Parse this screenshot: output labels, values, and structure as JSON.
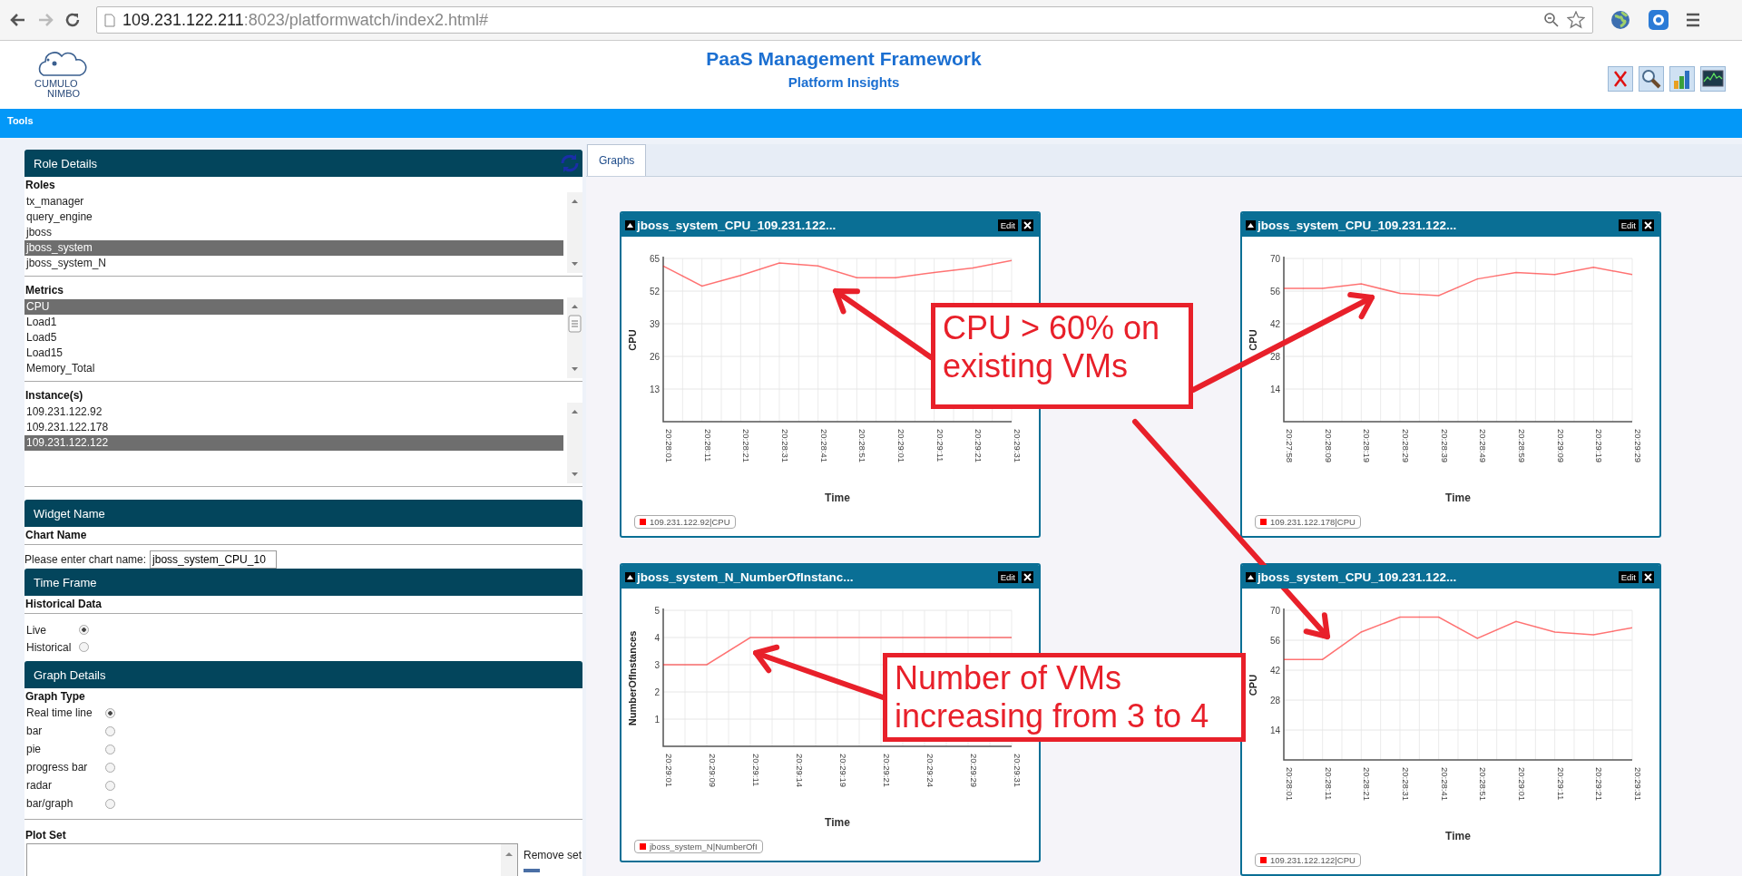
{
  "browser": {
    "url_host": "109.231.122.211",
    "url_path": ":8023/platformwatch/index2.html#"
  },
  "header": {
    "logo": [
      "CUMULO",
      "NIMBO"
    ],
    "title": "PaaS Management Framework",
    "subtitle": "Platform Insights"
  },
  "menu_bar": [
    "Tools"
  ],
  "sidebar": {
    "role_details": {
      "title": "Role Details",
      "lists": [
        {
          "label": "Roles",
          "items": [
            {
              "text": "tx_manager",
              "selected": false
            },
            {
              "text": "query_engine",
              "selected": false
            },
            {
              "text": "jboss",
              "selected": false
            },
            {
              "text": "jboss_system",
              "selected": true
            },
            {
              "text": "jboss_system_N",
              "selected": false
            }
          ]
        },
        {
          "label": "Metrics",
          "items": [
            {
              "text": "CPU",
              "selected": true
            },
            {
              "text": "Load1",
              "selected": false
            },
            {
              "text": "Load5",
              "selected": false
            },
            {
              "text": "Load15",
              "selected": false
            },
            {
              "text": "Memory_Total",
              "selected": false
            }
          ]
        },
        {
          "label": "Instance(s)",
          "items": [
            {
              "text": "109.231.122.92",
              "selected": false
            },
            {
              "text": "109.231.122.178",
              "selected": false
            },
            {
              "text": "109.231.122.122",
              "selected": true
            }
          ]
        }
      ]
    },
    "widget_name": {
      "title": "Widget Name",
      "heading": "Chart Name",
      "field_label": "Please enter chart name:",
      "field_value": "jboss_system_CPU_10"
    },
    "time_frame": {
      "title": "Time Frame",
      "heading": "Historical Data",
      "options": [
        {
          "label": "Live",
          "selected": true
        },
        {
          "label": "Historical",
          "selected": false
        }
      ]
    },
    "graph_details": {
      "title": "Graph Details",
      "heading": "Graph Type",
      "options": [
        {
          "label": "Real time line",
          "selected": true
        },
        {
          "label": "bar",
          "selected": false
        },
        {
          "label": "pie",
          "selected": false
        },
        {
          "label": "progress bar",
          "selected": false
        },
        {
          "label": "radar",
          "selected": false
        },
        {
          "label": "bar/graph",
          "selected": false
        }
      ]
    },
    "plot_set": {
      "heading": "Plot Set",
      "remove_label": "Remove set"
    }
  },
  "tabs": [
    {
      "label": "Graphs",
      "selected": true
    }
  ],
  "widgets": [
    {
      "title": "jboss_system_CPU_109.231.122...",
      "edit_label": "Edit",
      "chart_data": {
        "type": "line",
        "xlabel": "Time",
        "ylabel": "CPU",
        "categories": [
          "20:28:01",
          "20:28:11",
          "20:28:21",
          "20:28:31",
          "20:28:41",
          "20:28:51",
          "20:29:01",
          "20:29:11",
          "20:29:21",
          "20:29:31"
        ],
        "ylim": [
          0,
          65
        ],
        "yticks": [
          13,
          26,
          39,
          52,
          65
        ],
        "grid": true,
        "series": [
          {
            "name": "109.231.122.92|CPU",
            "color": "#ff0000",
            "values": [
              62,
              54,
              58.2,
              63.2,
              62,
              57.3,
              57.3,
              59.4,
              61.2,
              64.2
            ]
          }
        ]
      }
    },
    {
      "title": "jboss_system_CPU_109.231.122...",
      "edit_label": "Edit",
      "chart_data": {
        "type": "line",
        "xlabel": "Time",
        "ylabel": "CPU",
        "categories": [
          "20:27:58",
          "20:28:09",
          "20:28:19",
          "20:28:29",
          "20:28:39",
          "20:28:49",
          "20:28:59",
          "20:29:09",
          "20:29:19",
          "20:29:29"
        ],
        "ylim": [
          0,
          70
        ],
        "yticks": [
          14,
          28,
          42,
          56,
          70
        ],
        "grid": true,
        "series": [
          {
            "name": "109.231.122.178|CPU",
            "color": "#ff0000",
            "values": [
              57.2,
              57.2,
              59.1,
              55,
              54.1,
              61.2,
              64,
              63.1,
              66.2,
              63.1
            ]
          }
        ]
      }
    },
    {
      "title": "jboss_system_N_NumberOfInstanc...",
      "edit_label": "Edit",
      "chart_data": {
        "type": "line",
        "xlabel": "Time",
        "ylabel": "NumberOfInstances",
        "categories": [
          "20:29:01",
          "20:29:09",
          "20:29:11",
          "20:29:14",
          "20:29:19",
          "20:29:21",
          "20:29:24",
          "20:29:29",
          "20:29:31"
        ],
        "ylim": [
          0,
          5
        ],
        "yticks": [
          1,
          2,
          3,
          4,
          5
        ],
        "grid": true,
        "series": [
          {
            "name": "jboss_system_N|NumberOfI",
            "color": "#ff0000",
            "values": [
              3,
              3,
              4,
              4,
              4,
              4,
              4,
              4,
              4
            ]
          }
        ]
      }
    },
    {
      "title": "jboss_system_CPU_109.231.122...",
      "edit_label": "Edit",
      "chart_data": {
        "type": "line",
        "xlabel": "Time",
        "ylabel": "CPU",
        "categories": [
          "20:28:01",
          "20:28:11",
          "20:28:21",
          "20:28:31",
          "20:28:41",
          "20:28:51",
          "20:29:01",
          "20:29:11",
          "20:29:21",
          "20:29:31"
        ],
        "ylim": [
          0,
          70
        ],
        "yticks": [
          14,
          28,
          42,
          56,
          70
        ],
        "grid": true,
        "series": [
          {
            "name": "109.231.122.122|CPU",
            "color": "#ff0000",
            "values": [
              47,
              47,
              59.8,
              66.8,
              66.8,
              56.9,
              64.8,
              59.8,
              58.6,
              61.8
            ]
          }
        ]
      }
    }
  ],
  "annotations": [
    {
      "text": "CPU > 60% on existing VMs"
    },
    {
      "text": "Number of VMs increasing from 3 to 4"
    }
  ]
}
